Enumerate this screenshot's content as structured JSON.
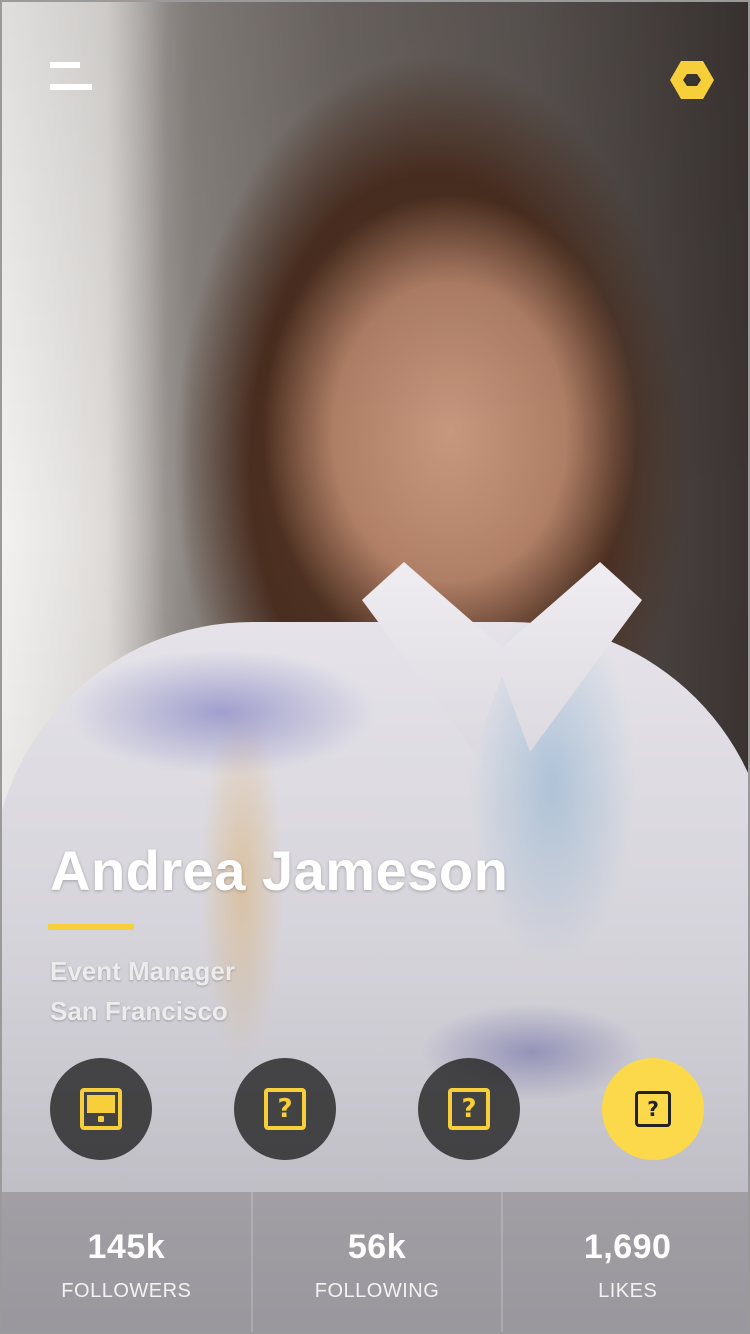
{
  "profile": {
    "name": "Andrea Jameson",
    "role": "Event Manager",
    "location": "San Francisco"
  },
  "icons": {
    "menu": "menu-icon",
    "settings": "hexagon-settings-icon",
    "action_1": "tablet-icon",
    "action_2": "question-icon",
    "action_3": "question-icon",
    "action_4": "question-icon"
  },
  "stats": [
    {
      "value": "145k",
      "label": "FOLLOWERS"
    },
    {
      "value": "56k",
      "label": "FOLLOWING"
    },
    {
      "value": "1,690",
      "label": "LIKES"
    }
  ],
  "colors": {
    "accent": "#f7cf3a",
    "button_dark": "#262626",
    "button_primary": "#fbd94a"
  }
}
